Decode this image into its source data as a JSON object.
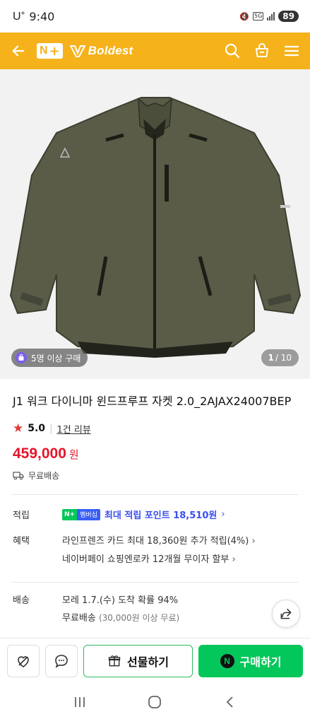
{
  "status": {
    "carrier": "U",
    "carrier_sup": "+",
    "time": "9:40",
    "network": "5G",
    "battery": "89"
  },
  "header": {
    "logo_n": "N",
    "logo_plus": "+",
    "brand": "Boldest"
  },
  "gallery": {
    "social_proof": "5명 이상 구매",
    "page_current": "1",
    "page_total": "/ 10"
  },
  "product": {
    "title": "J1 워크 다이니마 윈드프루프 자켓 2.0_2AJAX24007BEP",
    "rating": "5.0",
    "reviews": "1건 리뷰",
    "price": "459,000",
    "price_unit": "원",
    "shipping": "무료배송"
  },
  "info": {
    "points_label": "적립",
    "points_badge_n": "N+",
    "points_badge_member": "멤버십",
    "points_text": "최대 적립 포인트 18,510원",
    "benefit_label": "혜택",
    "benefit_1": "라인프렌즈 카드 최대 18,360원 추가 적립(4%)",
    "benefit_2": "네이버페이 쇼핑엔로카 12개월 무이자 할부",
    "delivery_label": "배송",
    "delivery_1": "모레 1.7.(수) 도착 확률 94%",
    "delivery_2": "무료배송",
    "delivery_2_sub": "(30,000원 이상 무료)"
  },
  "bottom": {
    "gift": "선물하기",
    "buy": "구매하기",
    "buy_n": "N"
  },
  "colors": {
    "header": "#f6b21b",
    "price": "#e5142a",
    "buy": "#03c75a",
    "point": "#3a4ff0"
  }
}
